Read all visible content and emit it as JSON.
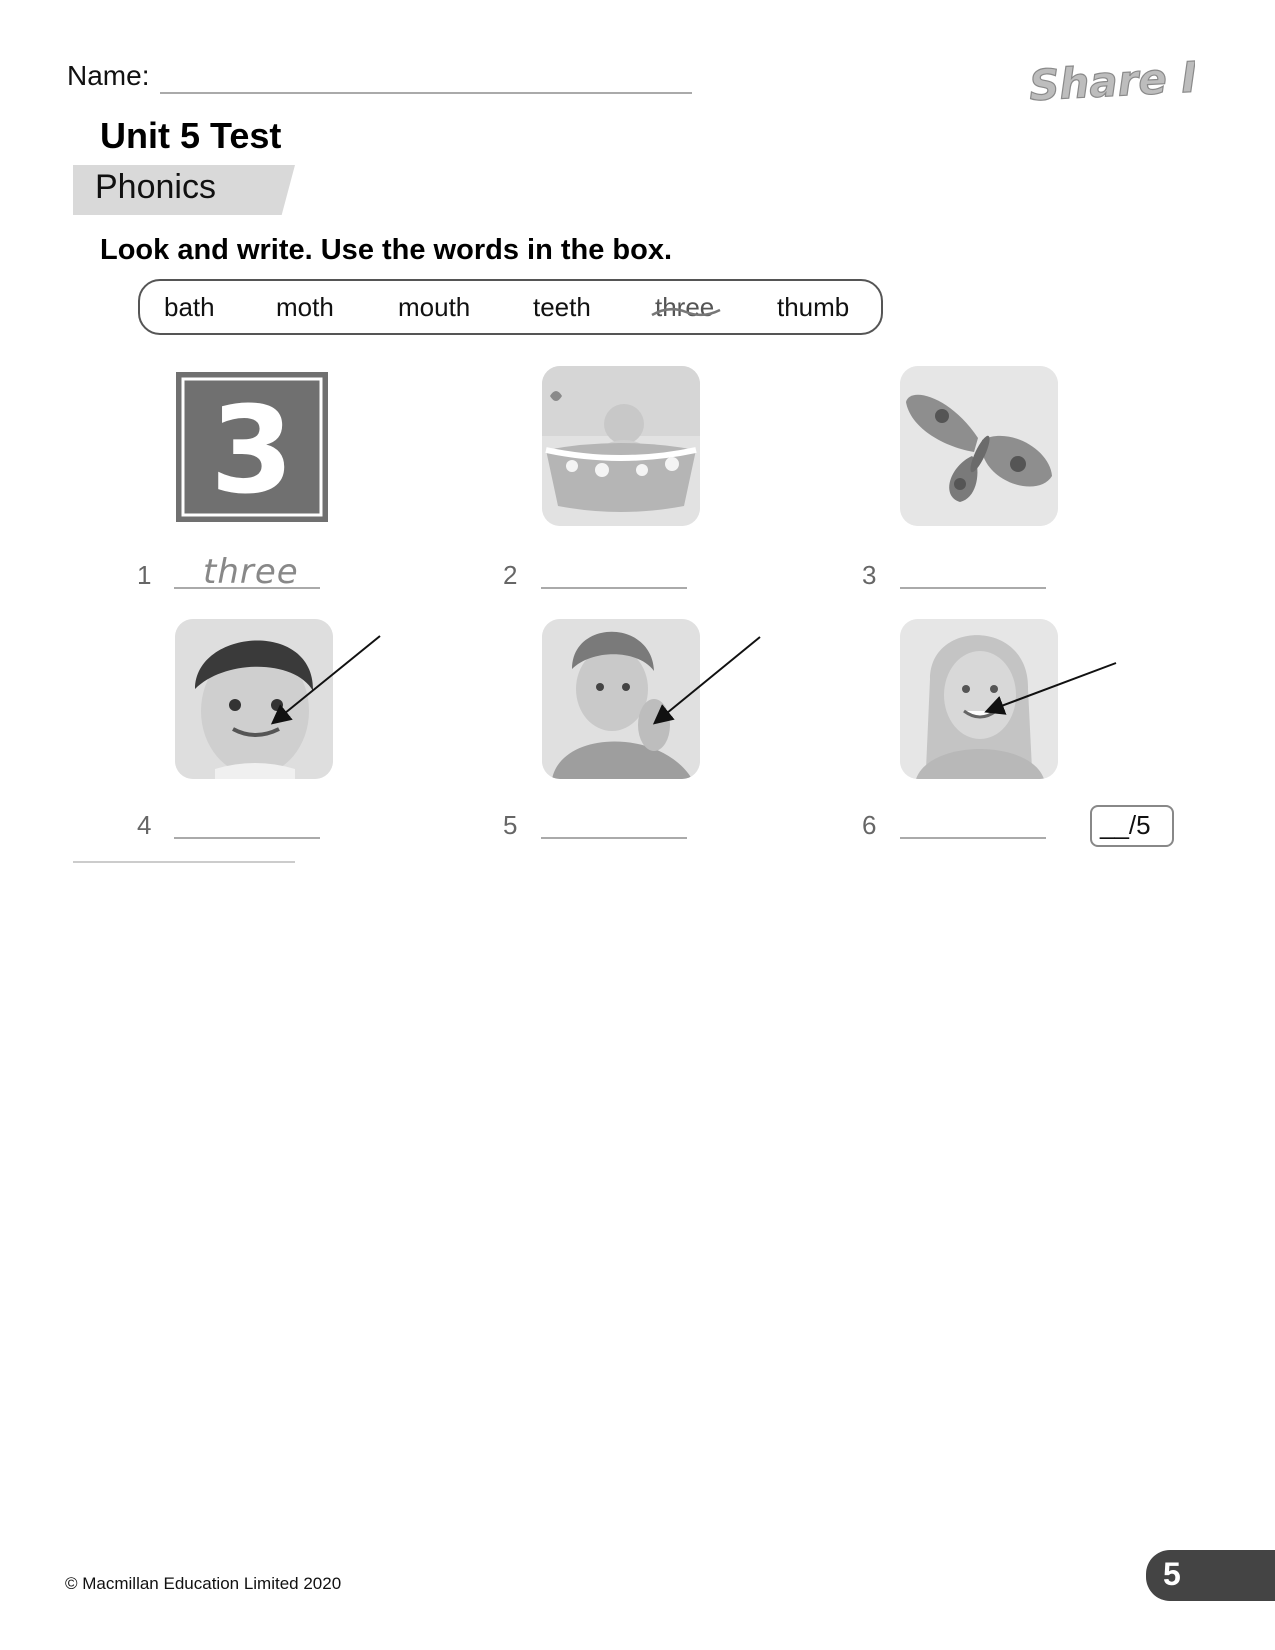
{
  "header": {
    "name_label": "Name:",
    "logo_text": "Share It!",
    "unit_title": "Unit 5 Test",
    "section": "Phonics"
  },
  "exercise": {
    "instruction": "Look and write. Use the words in the box.",
    "word_box": [
      "bath",
      "moth",
      "mouth",
      "teeth",
      "three",
      "thumb"
    ],
    "items": [
      {
        "number": "1",
        "picture": "number-three-sign",
        "answer": "three"
      },
      {
        "number": "2",
        "picture": "baby-in-bath",
        "answer": ""
      },
      {
        "number": "3",
        "picture": "moth",
        "answer": ""
      },
      {
        "number": "4",
        "picture": "boy-mouth-arrow",
        "answer": ""
      },
      {
        "number": "5",
        "picture": "boy-thumb-arrow",
        "answer": ""
      },
      {
        "number": "6",
        "picture": "girl-teeth-arrow",
        "answer": ""
      }
    ],
    "score": "__/5"
  },
  "footer": {
    "copyright": "© Macmillan Education Limited 2020",
    "page_number": "5"
  }
}
